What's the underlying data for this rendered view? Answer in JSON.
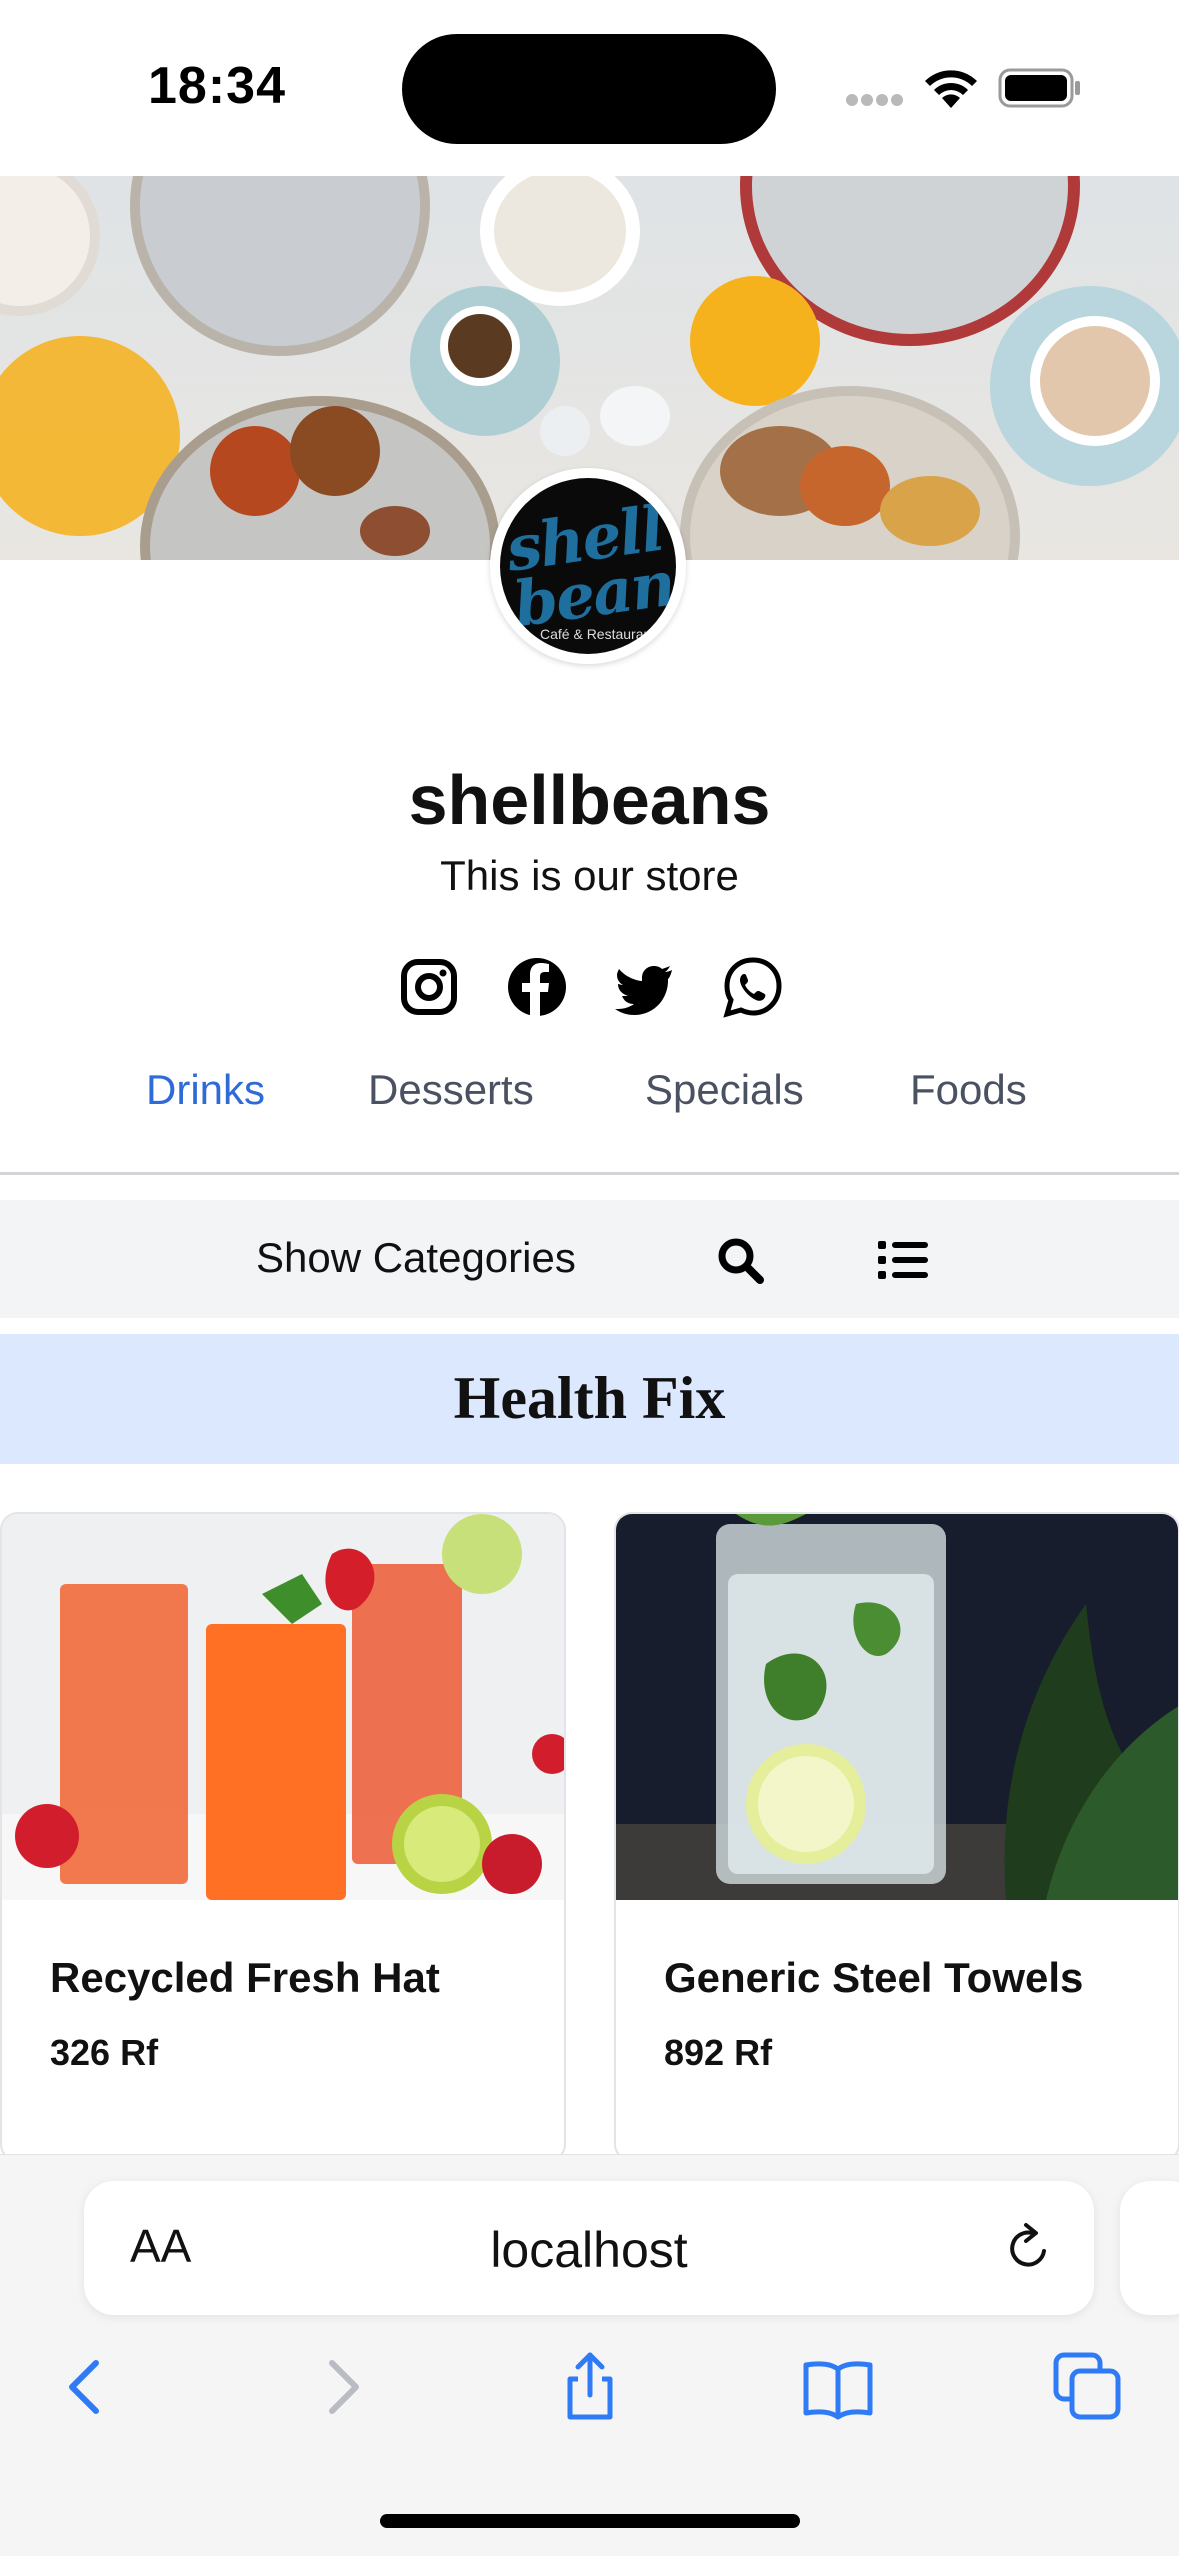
{
  "status_bar": {
    "time": "18:34"
  },
  "store": {
    "name": "shellbeans",
    "tagline": "This is our store",
    "logo_text": "shell beans",
    "logo_subtext": "Café & Restaurant"
  },
  "social": [
    "instagram-icon",
    "facebook-icon",
    "twitter-icon",
    "whatsapp-icon"
  ],
  "tabs": [
    {
      "label": "Drinks",
      "active": true
    },
    {
      "label": "Desserts",
      "active": false
    },
    {
      "label": "Specials",
      "active": false
    },
    {
      "label": "Foods",
      "active": false
    }
  ],
  "toolbar": {
    "show_categories": "Show Categories"
  },
  "section": {
    "title": "Health Fix"
  },
  "products": [
    {
      "name": "Recycled Fresh Hat",
      "price": "326 Rf"
    },
    {
      "name": "Generic Steel Towels",
      "price": "892 Rf"
    }
  ],
  "browser": {
    "text_size_label": "AA",
    "url": "localhost"
  },
  "colors": {
    "accent": "#2f6bd8",
    "banner": "#dbe8fd",
    "toolbar": "#f3f4f6"
  }
}
